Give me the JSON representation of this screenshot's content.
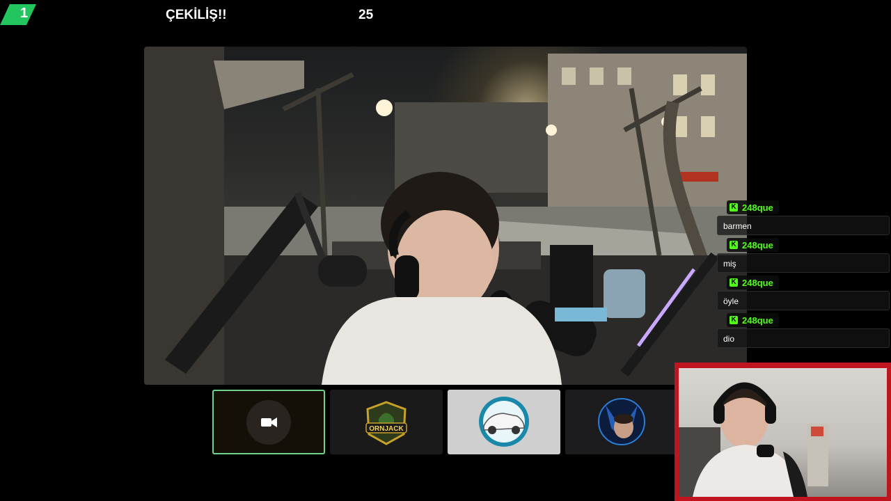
{
  "header": {
    "badge_number": "1",
    "title": "ÇEKİLİŞ!!",
    "count": "25"
  },
  "colors": {
    "accent": "#53fc18",
    "badge_green": "#22c55e",
    "webcam_frame": "#c0141e"
  },
  "chat": {
    "messages": [
      {
        "user": "248que",
        "text": "barmen"
      },
      {
        "user": "248que",
        "text": "miş"
      },
      {
        "user": "248que",
        "text": "öyle"
      },
      {
        "user": "248que",
        "text": "dio"
      }
    ]
  },
  "participants": [
    {
      "name": "camera-off",
      "icon": "video-camera-icon"
    },
    {
      "name": "ornjack",
      "logo_text": "ORNJACK"
    },
    {
      "name": "car-avatar",
      "icon": "car-icon"
    },
    {
      "name": "wolf-avatar",
      "icon": "wolf-icon"
    }
  ]
}
